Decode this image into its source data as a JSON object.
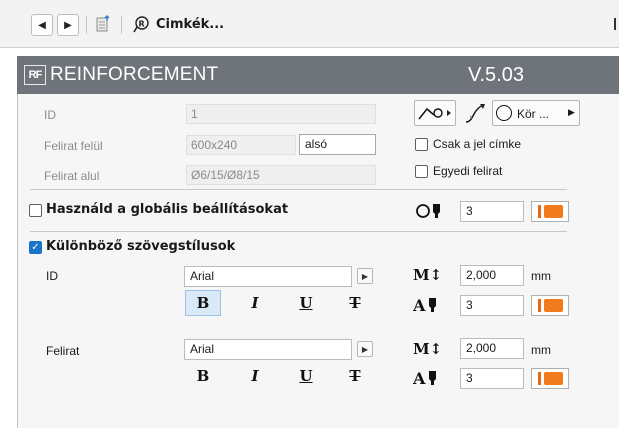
{
  "toolbar": {
    "back_icon": "triangle-left-icon",
    "forward_icon": "triangle-right-icon",
    "title": "Cimkék..."
  },
  "header": {
    "title": "REINFORCEMENT",
    "version": "V.5.03",
    "logo_text": "RF"
  },
  "fields": {
    "id_label": "ID",
    "id_value": "1",
    "felirat_felul_label": "Felirat felül",
    "felirat_felul_value": "600x240",
    "felirat_felul_position": "alsó",
    "felirat_alul_label": "Felirat alul",
    "felirat_alul_value": "Ø6/15/Ø8/15"
  },
  "marker": {
    "shape_label": "Kör ...",
    "only_label_checkbox": "Csak a jel címke",
    "only_label_checked": false,
    "custom_caption_checkbox": "Egyedi felirat",
    "custom_caption_checked": false
  },
  "global": {
    "use_global_label": "Használd a globális beállításokat",
    "use_global_checked": false,
    "pen_value": "3",
    "color": "#f07a1c"
  },
  "text_styles": {
    "different_styles_label": "Különböző szövegstílusok",
    "different_styles_checked": true,
    "id_section": {
      "label": "ID",
      "font": "Arial",
      "height": "2,000",
      "unit": "mm",
      "pen": "3",
      "bold_active": true
    },
    "felirat_section": {
      "label": "Felirat",
      "font": "Arial",
      "height": "2,000",
      "unit": "mm",
      "pen": "3",
      "bold_active": false
    },
    "style_buttons": {
      "bold": "B",
      "italic": "I",
      "underline": "U",
      "strike": "T"
    }
  }
}
